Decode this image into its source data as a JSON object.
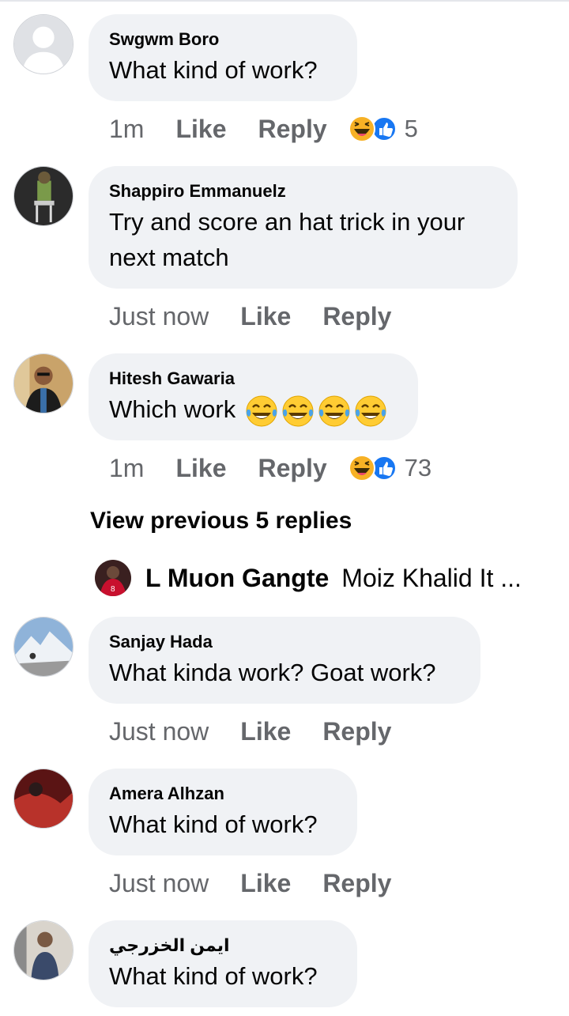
{
  "comments": [
    {
      "author": "Swgwm Boro",
      "text": "What kind of work?",
      "time": "1m",
      "like": "Like",
      "reply": "Reply",
      "reaction_count": "5",
      "reactions": [
        "haha-icon",
        "like-icon"
      ]
    },
    {
      "author": "Shappiro Emmanuelz",
      "text_line1": "Try and score an hat trick in your",
      "text_line2": "next match",
      "time": "Just now",
      "like": "Like",
      "reply": "Reply"
    },
    {
      "author": "Hitesh Gawaria",
      "text": "Which work",
      "text_emojis": [
        "laughing-crying-icon",
        "laughing-crying-icon",
        "laughing-crying-icon",
        "laughing-crying-icon"
      ],
      "time": "1m",
      "like": "Like",
      "reply": "Reply",
      "reaction_count": "73",
      "reactions": [
        "haha-icon",
        "like-icon"
      ]
    },
    {
      "author": "Sanjay Hada",
      "text": "What kinda work? Goat work?",
      "time": "Just now",
      "like": "Like",
      "reply": "Reply"
    },
    {
      "author": "Amera Alhzan",
      "text": "What kind of work?",
      "time": "Just now",
      "like": "Like",
      "reply": "Reply"
    },
    {
      "author": "ايمن الخزرجي",
      "text": "What kind of work?"
    }
  ],
  "thread": {
    "view_previous": "View previous 5 replies",
    "reply_author": "L Muon Gangte",
    "reply_text": "Moiz Khalid  It ..."
  },
  "colors": {
    "bubble": "#f0f2f5",
    "meta": "#65676b",
    "like_blue": "#1877f2",
    "haha_yellow": "#f7b125"
  }
}
